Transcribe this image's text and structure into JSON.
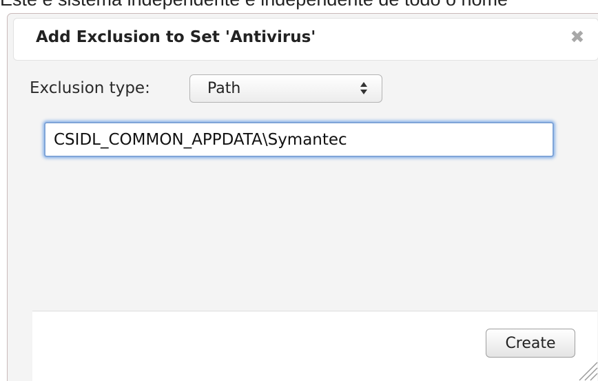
{
  "background": {
    "text": "Este é sistema independente e independente de todo o nome"
  },
  "dialog": {
    "title": "Add Exclusion to Set 'Antivirus'",
    "close_glyph": "✖",
    "close_icon": "close-icon",
    "exclusion_type_label": "Exclusion type:",
    "exclusion_type_value": "Path",
    "select_icon": "up-down-arrows-icon",
    "path_value": "CSIDL_COMMON_APPDATA\\Symantec",
    "create_label": "Create",
    "resize_icon": "resize-grip-icon"
  },
  "colors": {
    "focus_ring": "#5b96e5",
    "dialog_bg": "#f4f4f4",
    "close_icon": "#a8a8a8"
  }
}
